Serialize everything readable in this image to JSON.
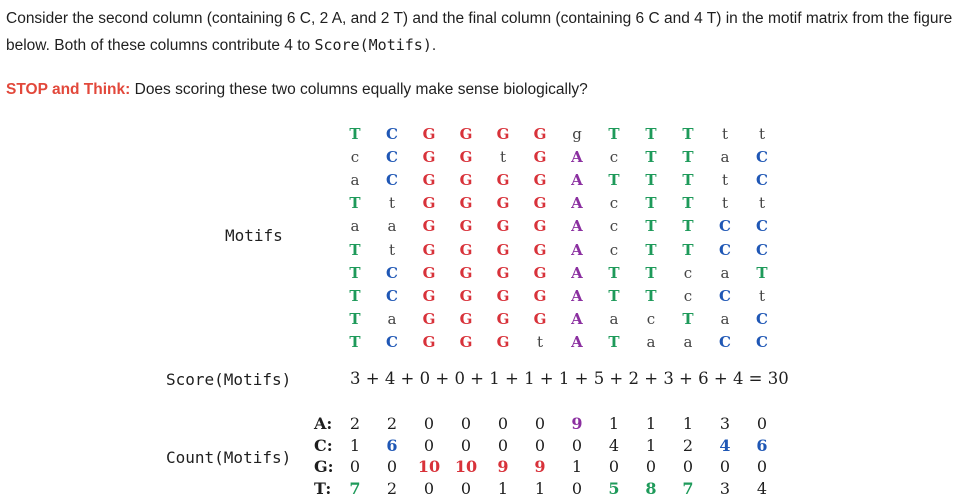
{
  "intro": {
    "text_before_code": "Consider the second column (containing 6 C, 2 A, and 2 T) and the final column (containing 6 C and 4 T) in the motif matrix from the figure below. Both of these columns contribute 4 to ",
    "code": "Score(Motifs)",
    "text_after_code": "."
  },
  "stop": {
    "label": "STOP and Think:",
    "question": " Does scoring these two columns equally make sense biologically?"
  },
  "labels": {
    "motifs": "Motifs",
    "score": "Score(Motifs)",
    "count": "Count(Motifs)"
  },
  "colors": {
    "A": "#8b2fa0",
    "C": "#1f57b5",
    "G": "#d8323a",
    "T": "#1e9a5a",
    "lower": "#444444"
  },
  "motifs": [
    "TCGGGGgTTTtt",
    "cCGGtGAcTTaC",
    "aCGGGGATTTtC",
    "TtGGGGAcTTtt",
    "aaGGGGAcTTCC",
    "TtGGGGAcTTCC",
    "TCGGGGATTcaT",
    "TCGGGGATTcCt",
    "TaGGGGAacTaC",
    "TCGGGtATaaCC"
  ],
  "score": {
    "expression": "3 + 4 + 0 + 0 + 1 + 1 + 1 + 5 + 2 + 3 + 6 + 4 = 30"
  },
  "count": {
    "nucleotides": [
      "A:",
      "C:",
      "G:",
      "T:"
    ],
    "rows": [
      [
        "2",
        "2",
        "0",
        "0",
        "0",
        "0",
        "9",
        "1",
        "1",
        "1",
        "3",
        "0"
      ],
      [
        "1",
        "6",
        "0",
        "0",
        "0",
        "0",
        "0",
        "4",
        "1",
        "2",
        "4",
        "6"
      ],
      [
        "0",
        "0",
        "10",
        "10",
        "9",
        "9",
        "1",
        "0",
        "0",
        "0",
        "0",
        "0"
      ],
      [
        "7",
        "2",
        "0",
        "0",
        "1",
        "1",
        "0",
        "5",
        "8",
        "7",
        "3",
        "4"
      ]
    ],
    "bold": [
      [
        false,
        false,
        false,
        false,
        false,
        false,
        true,
        false,
        false,
        false,
        false,
        false
      ],
      [
        false,
        true,
        false,
        false,
        false,
        false,
        false,
        false,
        false,
        false,
        true,
        true
      ],
      [
        false,
        false,
        true,
        true,
        true,
        true,
        false,
        false,
        false,
        false,
        false,
        false
      ],
      [
        true,
        false,
        false,
        false,
        false,
        false,
        false,
        true,
        true,
        true,
        false,
        false
      ]
    ],
    "bold_color": [
      "#8b2fa0",
      "#1f57b5",
      "#d8323a",
      "#1e9a5a"
    ]
  }
}
